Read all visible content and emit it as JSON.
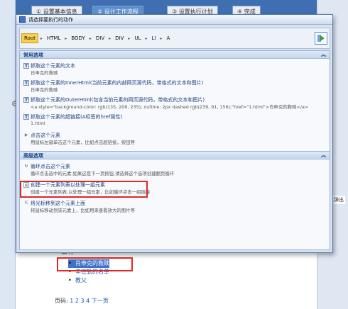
{
  "background": {
    "tabs": [
      "① 设置基本信息",
      "② 设计工作流程",
      "③ 设置执行计划",
      "④ 完成"
    ],
    "heading": "名称",
    "list_items": [
      "肖申克的救赎",
      "辛德勒的名单",
      "教父"
    ],
    "pager_label": "页码:",
    "pager_links": "1 2 3 4 下一页",
    "right_text": "上弹出"
  },
  "dialog": {
    "title": "请选择要执行的动作",
    "path": [
      "Root",
      "HTML",
      "BODY",
      "DIV",
      "DIV",
      "UL",
      "LI",
      "A"
    ],
    "sections": [
      {
        "header": "常用选项",
        "items": [
          {
            "title": "抓取这个元素的文本",
            "desc": "肖申克的救赎"
          },
          {
            "title": "抓取这个元素的InnerHtml(当前元素的内部网页源代码，带格式的文本和图片)",
            "desc": "肖申克的救赎"
          },
          {
            "title": "抓取这个元素的OuterHtml(包含当前元素的网页源代码，带格式的文本和图片)",
            "desc": "<a style=\"background-color: rgb(135, 206, 235); outline: 2px dashed rgb(239, 91, 156);\"href=\"1.html\">肖申克的救赎</a>"
          },
          {
            "title": "抓取这个元素的超链接(A标签的href属性)",
            "desc": "1.html"
          },
          {
            "title": "点击这个元素",
            "desc": "用鼠标左键单击这个元素，比如点击超链接，按钮等"
          }
        ]
      },
      {
        "header": "高级选项",
        "items": [
          {
            "title": "循环点击这个元素",
            "desc": "循环点击选中的元素,如果这是下一页按钮,请选择这个选项创建翻页循环"
          },
          {
            "title": "创建一个元素列表以处理一组元素",
            "desc": "创建一个元素列表,以处理一组元素，比如循环点击一组链接"
          },
          {
            "title": "将光标移到这个元素上面",
            "desc": "将鼠标移动到该元素上，比如用来查看放大的图片等"
          }
        ]
      }
    ]
  }
}
